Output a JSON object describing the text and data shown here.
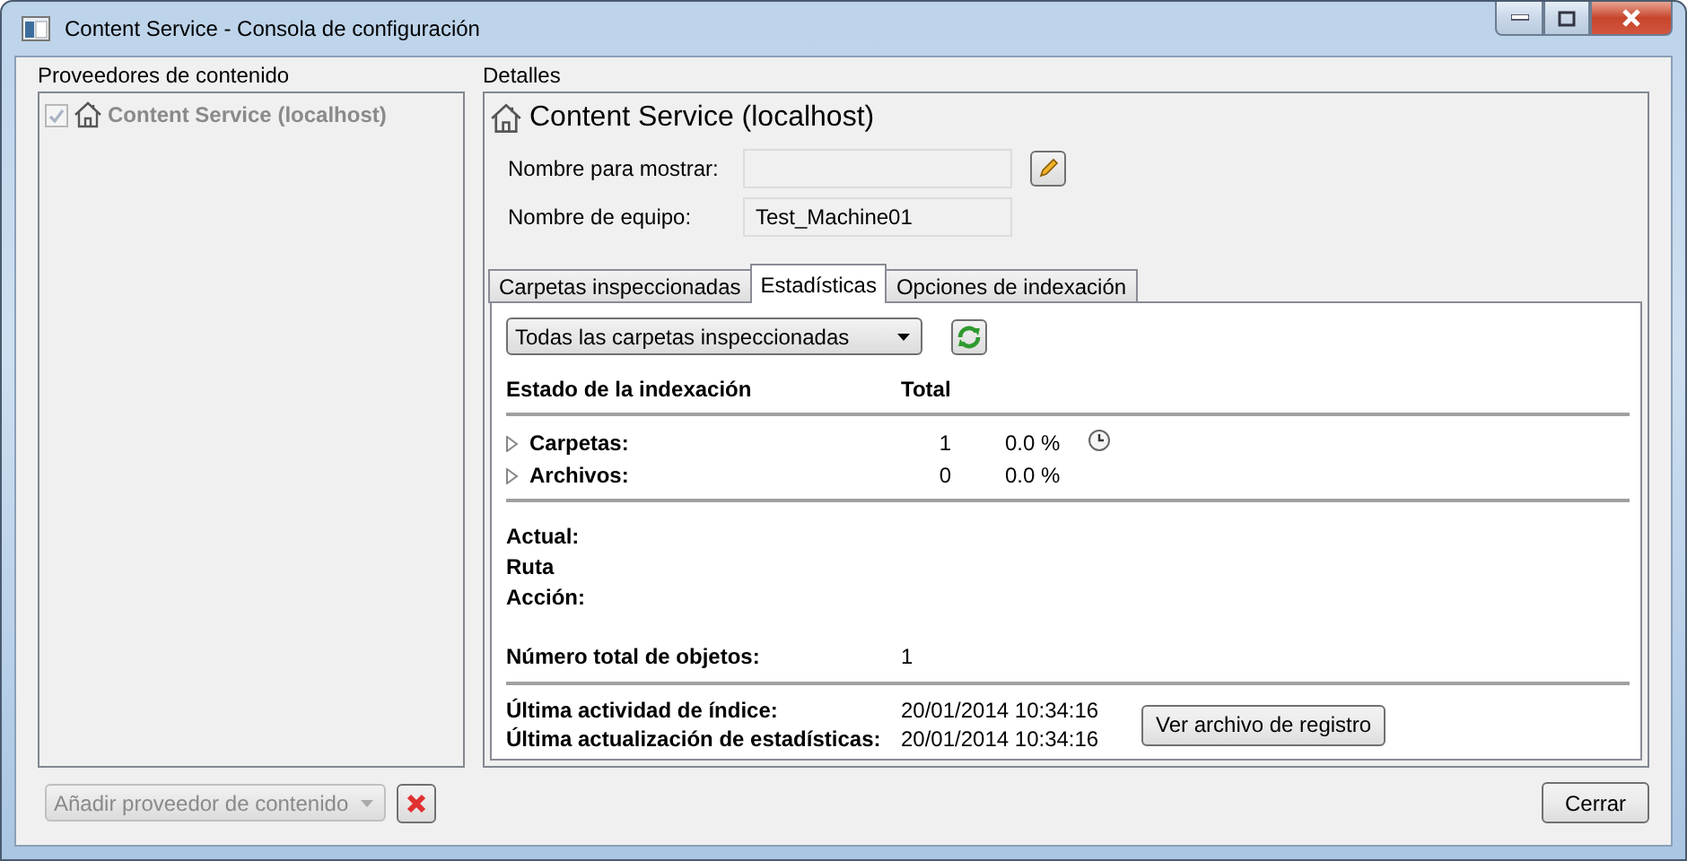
{
  "window": {
    "title": "Content Service - Consola de configuración"
  },
  "providers": {
    "label": "Proveedores de contenido",
    "items": [
      {
        "label": "Content Service (localhost)",
        "checked": true,
        "disabled": true
      }
    ],
    "add_provider": {
      "value": "Añadir proveedor de contenido",
      "disabled": true
    }
  },
  "details": {
    "label": "Detalles",
    "title": "Content Service (localhost)",
    "fields": [
      {
        "label": "Nombre para mostrar:",
        "editable": true
      },
      {
        "label": "Nombre de equipo:",
        "value": "Test_Machine01",
        "editable": false
      }
    ],
    "tabs": [
      {
        "label": "Carpetas inspeccionadas",
        "selected": false
      },
      {
        "label": "Estadísticas",
        "selected": true
      },
      {
        "label": "Opciones de indexación",
        "selected": false
      }
    ],
    "statistics": {
      "folder_filter": "Todas las carpetas inspeccionadas",
      "columns": [
        "Estado de la indexación",
        "Total"
      ],
      "rows": [
        {
          "label": "Carpetas:",
          "total": "1",
          "percent": "0.0 %",
          "expanded": false,
          "scheduled": true
        },
        {
          "label": "Archivos:",
          "total": "0",
          "percent": "0.0 %",
          "expanded": false,
          "scheduled": false
        }
      ],
      "current": [
        "Actual:",
        "Ruta",
        "Acción:"
      ],
      "total_objects": {
        "label": "Número total de objetos:",
        "value": "1"
      },
      "timestamps": [
        {
          "label": "Última actividad de índice:",
          "value": "20/01/2014 10:34:16"
        },
        {
          "label": "Última actualización de estadísticas:",
          "value": "20/01/2014 10:34:16"
        }
      ],
      "log_button": "Ver archivo de registro"
    }
  },
  "close_button": "Cerrar"
}
